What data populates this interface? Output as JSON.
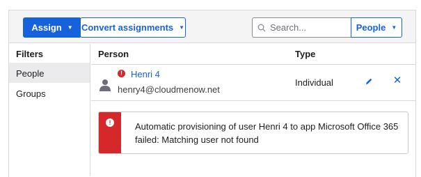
{
  "toolbar": {
    "assign_label": "Assign",
    "convert_label": "Convert assignments",
    "search_placeholder": "Search...",
    "search_value": "",
    "filter_select": "People"
  },
  "sidebar": {
    "heading": "Filters",
    "items": [
      {
        "label": "People",
        "active": true
      },
      {
        "label": "Groups",
        "active": false
      }
    ]
  },
  "table": {
    "columns": [
      "Person",
      "Type"
    ],
    "rows": [
      {
        "name": "Henri 4",
        "email": "henry4@cloudmenow.net",
        "type": "Individual",
        "status_icon": "error-icon"
      }
    ]
  },
  "error": {
    "message": "Automatic provisioning of user Henri 4 to app Microsoft Office 365 failed: Matching user not found"
  },
  "colors": {
    "accent": "#1662dd",
    "error": "#d5282a",
    "toolbar_bg": "#f4f4f5",
    "active_filter_bg": "#ebebed"
  },
  "icons": {
    "dropdown": "caret-down-icon",
    "search": "search-icon",
    "avatar": "person-icon",
    "edit": "pencil-icon",
    "remove": "close-icon",
    "error": "error-icon"
  }
}
